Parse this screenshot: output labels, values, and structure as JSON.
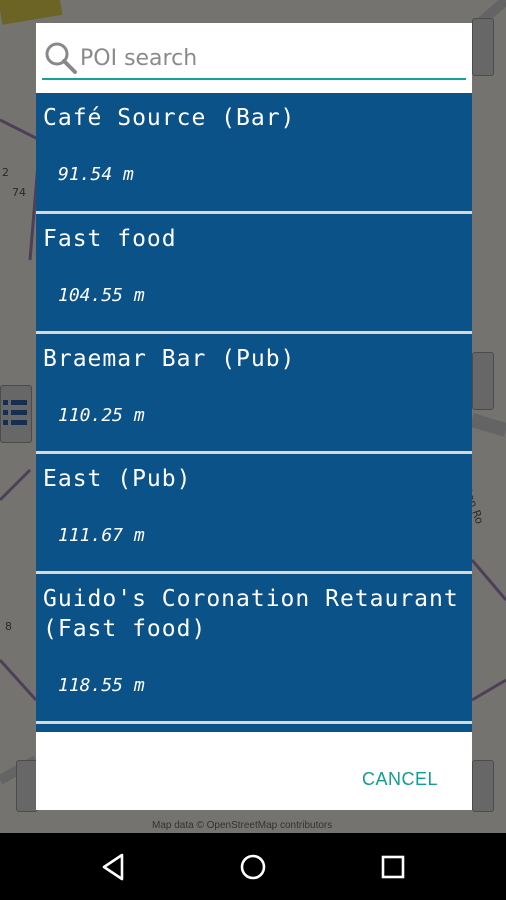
{
  "search": {
    "placeholder": "POI search",
    "value": ""
  },
  "poi_list": [
    {
      "name": "Café Source (Bar)",
      "distance": "91.54 m"
    },
    {
      "name": "Fast food",
      "distance": "104.55 m"
    },
    {
      "name": "Braemar Bar (Pub)",
      "distance": "110.25 m"
    },
    {
      "name": "East (Pub)",
      "distance": "111.67 m"
    },
    {
      "name": "Guido's Coronation Retaurant (Fast food)",
      "distance": "118.55 m"
    }
  ],
  "dialog": {
    "cancel_label": "CANCEL"
  },
  "map": {
    "attribution": "Map data © OpenStreetMap contributors",
    "labels": [
      "74",
      "2",
      "8",
      "ton Ro"
    ]
  },
  "colors": {
    "item_background": "#0b5289",
    "accent": "#129e8f",
    "nav_background": "#000000"
  },
  "navbar": {
    "icons": [
      "back-icon",
      "home-icon",
      "recents-icon"
    ]
  }
}
